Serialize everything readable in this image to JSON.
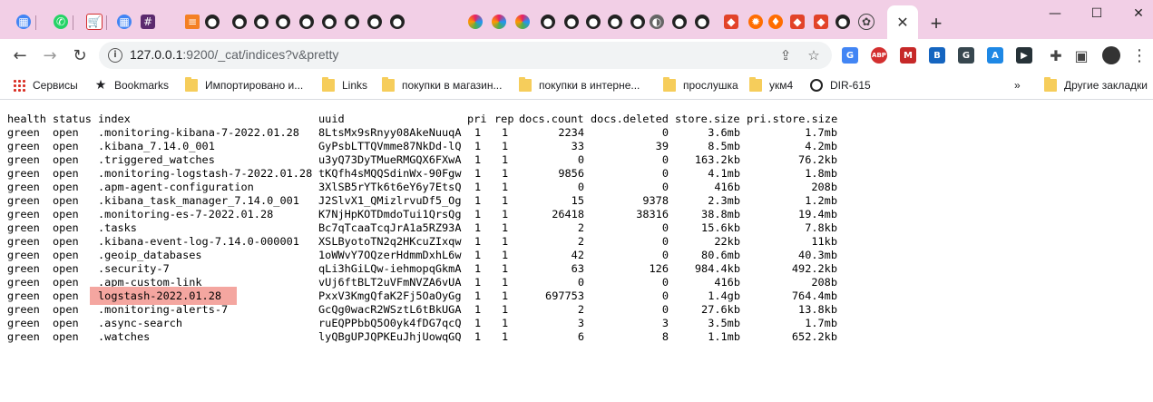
{
  "window": {
    "controls": {
      "minimize": "—",
      "maximize": "☐",
      "close": "✕"
    },
    "new_tab": "+",
    "active_tab_close": "✕"
  },
  "tabs": [
    {
      "icon": "multi-apps-icon"
    },
    {
      "icon": "whatsapp-icon"
    },
    {
      "icon": "shopping-cart-icon"
    },
    {
      "icon": "multi-apps-icon"
    },
    {
      "icon": "slack-icon"
    },
    {
      "icon": "stackoverflow-icon"
    },
    {
      "icon": "github-icon"
    },
    {
      "icon": "github-icon"
    },
    {
      "icon": "github-icon"
    },
    {
      "icon": "github-icon"
    },
    {
      "icon": "github-icon"
    },
    {
      "icon": "github-icon"
    },
    {
      "icon": "github-icon"
    },
    {
      "icon": "github-icon"
    },
    {
      "icon": "github-icon"
    },
    {
      "icon": "colorful-apps-icon"
    },
    {
      "icon": "colorful-apps-icon"
    },
    {
      "icon": "colorful-apps-icon"
    },
    {
      "icon": "github-icon"
    },
    {
      "icon": "github-icon"
    },
    {
      "icon": "github-icon"
    },
    {
      "icon": "github-icon"
    },
    {
      "icon": "github-icon"
    },
    {
      "icon": "grey-globe-icon"
    },
    {
      "icon": "github-icon"
    },
    {
      "icon": "github-icon"
    },
    {
      "icon": "gitlab-icon"
    },
    {
      "icon": "orange-gear-icon"
    },
    {
      "icon": "orange-flame-icon"
    },
    {
      "icon": "gitlab-icon"
    },
    {
      "icon": "gitlab-icon"
    },
    {
      "icon": "github-icon"
    },
    {
      "icon": "openai-icon"
    }
  ],
  "toolbar": {
    "url_host": "127.0.0.1",
    "url_rest": ":9200/_cat/indices?v&pretty"
  },
  "extensions": [
    {
      "icon": "google-translate-icon",
      "label": "G",
      "color": "#4285f4"
    },
    {
      "icon": "adblock-plus-icon",
      "label": "ABP",
      "color": "#d32f2f"
    },
    {
      "icon": "m-extension-icon",
      "label": "M",
      "color": "#c62828"
    },
    {
      "icon": "blue-bars-icon",
      "label": "B",
      "color": "#1565c0"
    },
    {
      "icon": "grammar-icon",
      "label": "G",
      "color": "#37474f"
    },
    {
      "icon": "acrobat-icon",
      "label": "A",
      "color": "#1e88e5"
    },
    {
      "icon": "cursor-extension-icon",
      "label": "▶",
      "color": "#263238"
    }
  ],
  "bookmarks": [
    {
      "icon": "apps-grid-icon",
      "label": "Сервисы"
    },
    {
      "icon": "star-icon",
      "label": "Bookmarks"
    },
    {
      "icon": "folder-icon",
      "label": "Импортировано и..."
    },
    {
      "icon": "folder-icon",
      "label": "Links"
    },
    {
      "icon": "folder-icon",
      "label": "покупки в магазин..."
    },
    {
      "icon": "folder-icon",
      "label": "покупки в интерне..."
    },
    {
      "icon": "folder-icon",
      "label": "прослушка"
    },
    {
      "icon": "folder-icon",
      "label": "укм4"
    },
    {
      "icon": "globe-icon",
      "label": "DIR-615"
    }
  ],
  "bookmarks_overflow": "»",
  "other_bookmarks": "Другие закладки",
  "table": {
    "headers": [
      "health",
      "status",
      "index",
      "uuid",
      "pri",
      "rep",
      "docs.count",
      "docs.deleted",
      "store.size",
      "pri.store.size"
    ],
    "highlighted_row": 13,
    "rows": [
      [
        "green",
        "open",
        ".monitoring-kibana-7-2022.01.28",
        "8LtsMx9sRnyy08AkeNuuqA",
        "1",
        "1",
        "2234",
        "0",
        "3.6mb",
        "1.7mb"
      ],
      [
        "green",
        "open",
        ".kibana_7.14.0_001",
        "GyPsbLTTQVmme87NkDd-lQ",
        "1",
        "1",
        "33",
        "39",
        "8.5mb",
        "4.2mb"
      ],
      [
        "green",
        "open",
        ".triggered_watches",
        "u3yQ73DyTMueRMGQX6FXwA",
        "1",
        "1",
        "0",
        "0",
        "163.2kb",
        "76.2kb"
      ],
      [
        "green",
        "open",
        ".monitoring-logstash-7-2022.01.28",
        "tKQfh4sMQQSdinWx-90Fgw",
        "1",
        "1",
        "9856",
        "0",
        "4.1mb",
        "1.8mb"
      ],
      [
        "green",
        "open",
        ".apm-agent-configuration",
        "3XlSB5rYTk6t6eY6y7EtsQ",
        "1",
        "1",
        "0",
        "0",
        "416b",
        "208b"
      ],
      [
        "green",
        "open",
        ".kibana_task_manager_7.14.0_001",
        "J2SlvX1_QMizlrvuDf5_Og",
        "1",
        "1",
        "15",
        "9378",
        "2.3mb",
        "1.2mb"
      ],
      [
        "green",
        "open",
        ".monitoring-es-7-2022.01.28",
        "K7NjHpKOTDmdoTui1QrsQg",
        "1",
        "1",
        "26418",
        "38316",
        "38.8mb",
        "19.4mb"
      ],
      [
        "green",
        "open",
        ".tasks",
        "Bc7qTcaaTcqJrA1a5RZ93A",
        "1",
        "1",
        "2",
        "0",
        "15.6kb",
        "7.8kb"
      ],
      [
        "green",
        "open",
        ".kibana-event-log-7.14.0-000001",
        "XSLByotoTN2q2HKcuZIxqw",
        "1",
        "1",
        "2",
        "0",
        "22kb",
        "11kb"
      ],
      [
        "green",
        "open",
        ".geoip_databases",
        "1oWWvY7OQzerHdmmDxhL6w",
        "1",
        "1",
        "42",
        "0",
        "80.6mb",
        "40.3mb"
      ],
      [
        "green",
        "open",
        ".security-7",
        "qLi3hGiLQw-iehmopqGkmA",
        "1",
        "1",
        "63",
        "126",
        "984.4kb",
        "492.2kb"
      ],
      [
        "green",
        "open",
        ".apm-custom-link",
        "vUj6ftBLT2uVFmNVZA6vUA",
        "1",
        "1",
        "0",
        "0",
        "416b",
        "208b"
      ],
      [
        "green",
        "open",
        "logstash-2022.01.28",
        "PxxV3KmgQfaK2Fj5OaOyGg",
        "1",
        "1",
        "697753",
        "0",
        "1.4gb",
        "764.4mb"
      ],
      [
        "green",
        "open",
        ".monitoring-alerts-7",
        "GcQg0wacR2WSztL6tBkUGA",
        "1",
        "1",
        "2",
        "0",
        "27.6kb",
        "13.8kb"
      ],
      [
        "green",
        "open",
        ".async-search",
        "ruEQPPbbQ5O0yk4fDG7qcQ",
        "1",
        "1",
        "3",
        "3",
        "3.5mb",
        "1.7mb"
      ],
      [
        "green",
        "open",
        ".watches",
        "lyQBgUPJQPKEuJhjUowqGQ",
        "1",
        "1",
        "6",
        "8",
        "1.1mb",
        "652.2kb"
      ]
    ]
  }
}
